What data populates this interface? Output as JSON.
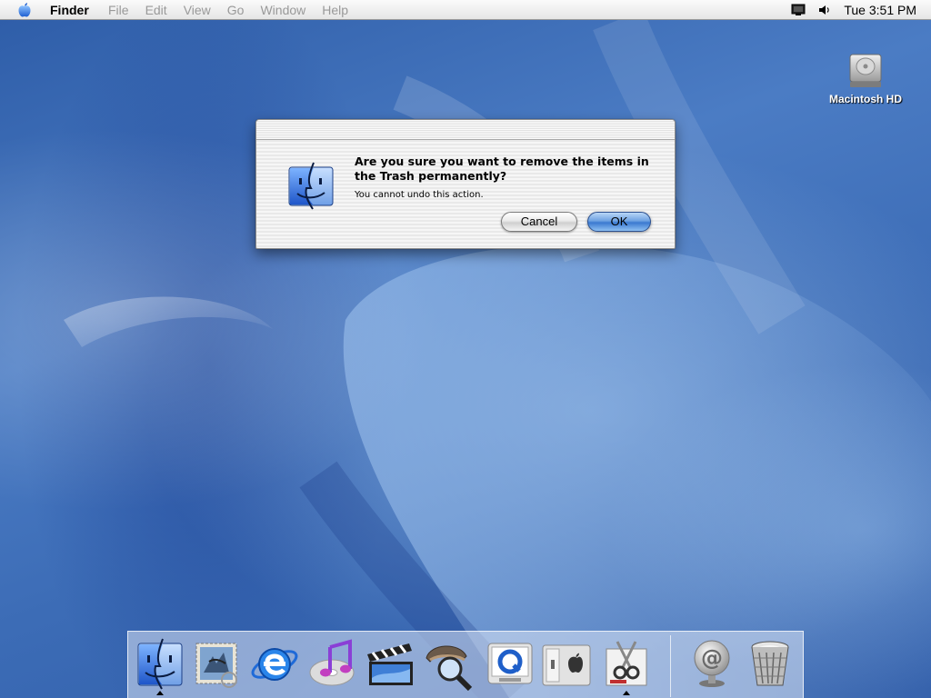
{
  "menubar": {
    "app_name": "Finder",
    "menus": [
      "File",
      "Edit",
      "View",
      "Go",
      "Window",
      "Help"
    ],
    "clock": "Tue 3:51 PM",
    "icons": [
      "apple-menu-icon",
      "display-icon",
      "volume-icon"
    ]
  },
  "desktop": {
    "hd_label": "Macintosh HD"
  },
  "dialog": {
    "message": "Are you sure you want to remove the items in the Trash permanently?",
    "info": "You cannot undo this action.",
    "cancel_label": "Cancel",
    "ok_label": "OK",
    "default_button": "OK"
  },
  "dock": {
    "items": [
      {
        "icon": "finder-icon",
        "running": true
      },
      {
        "icon": "mail-icon",
        "running": false
      },
      {
        "icon": "internet-explorer-icon",
        "running": false
      },
      {
        "icon": "itunes-icon",
        "running": false
      },
      {
        "icon": "imovie-icon",
        "running": false
      },
      {
        "icon": "sherlock-icon",
        "running": false
      },
      {
        "icon": "quicktime-icon",
        "running": false
      },
      {
        "icon": "system-preferences-icon",
        "running": false
      },
      {
        "icon": "clipboard-scissors-icon",
        "running": true
      },
      {
        "icon": "internet-connect-icon",
        "running": false
      },
      {
        "icon": "trash-icon",
        "running": false
      }
    ]
  },
  "colors": {
    "desktop_blue": "#3d6fb8",
    "ok_button_blue": "#3a79d0"
  }
}
